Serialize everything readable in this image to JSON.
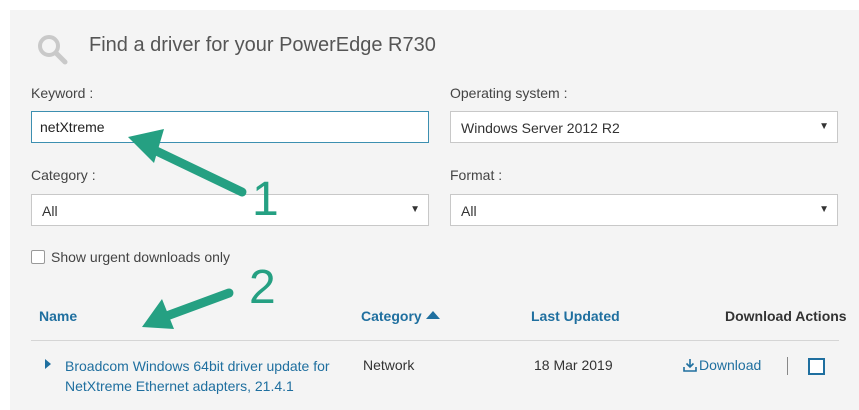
{
  "search": {
    "title": "Find a driver for your PowerEdge R730",
    "icon": "search-icon"
  },
  "filters": {
    "keyword_label": "Keyword :",
    "keyword_value": "netXtreme",
    "os_label": "Operating system :",
    "os_value": "Windows Server 2012 R2",
    "category_label": "Category :",
    "category_value": "All",
    "format_label": "Format :",
    "format_value": "All",
    "urgent_label": "Show urgent downloads only"
  },
  "table": {
    "headers": {
      "name": "Name",
      "category": "Category",
      "last_updated": "Last Updated",
      "actions": "Download Actions"
    },
    "rows": [
      {
        "name": "Broadcom Windows 64bit driver update for NetXtreme Ethernet adapters, 21.4.1",
        "category": "Network",
        "last_updated": "18 Mar 2019",
        "download_label": "Download"
      }
    ]
  },
  "annotations": {
    "one": "1",
    "two": "2",
    "color": "#25a082"
  },
  "colors": {
    "link": "#1f6f9f",
    "panel": "#f4f4f4"
  }
}
